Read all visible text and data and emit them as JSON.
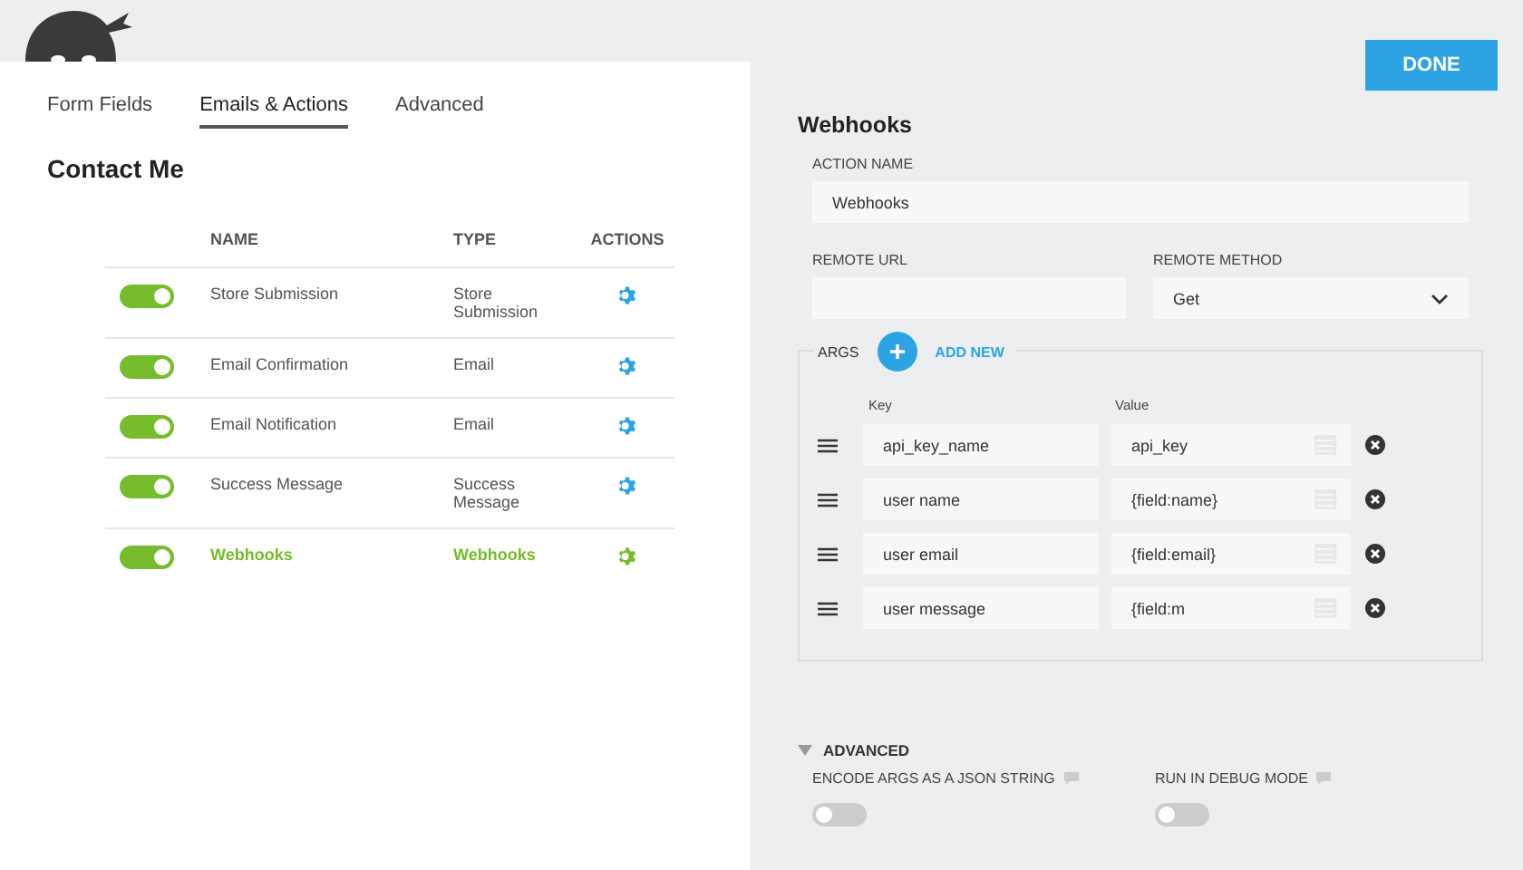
{
  "tabs": [
    {
      "label": "Form Fields",
      "selected": false
    },
    {
      "label": "Emails & Actions",
      "selected": true
    },
    {
      "label": "Advanced",
      "selected": false
    }
  ],
  "form_title": "Contact Me",
  "actions_table": {
    "columns": [
      "NAME",
      "TYPE",
      "ACTIONS"
    ],
    "rows": [
      {
        "on": true,
        "name": "Store Submission",
        "type": "Store Submission",
        "selected": false
      },
      {
        "on": true,
        "name": "Email Confirmation",
        "type": "Email",
        "selected": false
      },
      {
        "on": true,
        "name": "Email Notification",
        "type": "Email",
        "selected": false
      },
      {
        "on": true,
        "name": "Success Message",
        "type": "Success Message",
        "selected": false
      },
      {
        "on": true,
        "name": "Webhooks",
        "type": "Webhooks",
        "selected": true
      }
    ]
  },
  "done_button": "DONE",
  "settings": {
    "title": "Webhooks",
    "action_name": {
      "label": "ACTION NAME",
      "value": "Webhooks"
    },
    "remote_url": {
      "label": "REMOTE URL"
    },
    "remote_method": {
      "label": "REMOTE METHOD",
      "value": "Get"
    },
    "args": {
      "legend": "ARGS",
      "add_label": "ADD NEW",
      "key_header": "Key",
      "value_header": "Value",
      "rows": [
        {
          "key": "api_key_name",
          "value": "api_key"
        },
        {
          "key": "user name",
          "value": "{field:name}"
        },
        {
          "key": "user email",
          "value": "{field:email}"
        },
        {
          "key": "user message",
          "value": "{field:m"
        }
      ]
    },
    "advanced": {
      "label": "ADVANCED",
      "expanded": true,
      "options": [
        {
          "label": "ENCODE ARGS AS A JSON STRING",
          "on": false
        },
        {
          "label": "RUN IN DEBUG MODE",
          "on": false
        }
      ]
    }
  }
}
